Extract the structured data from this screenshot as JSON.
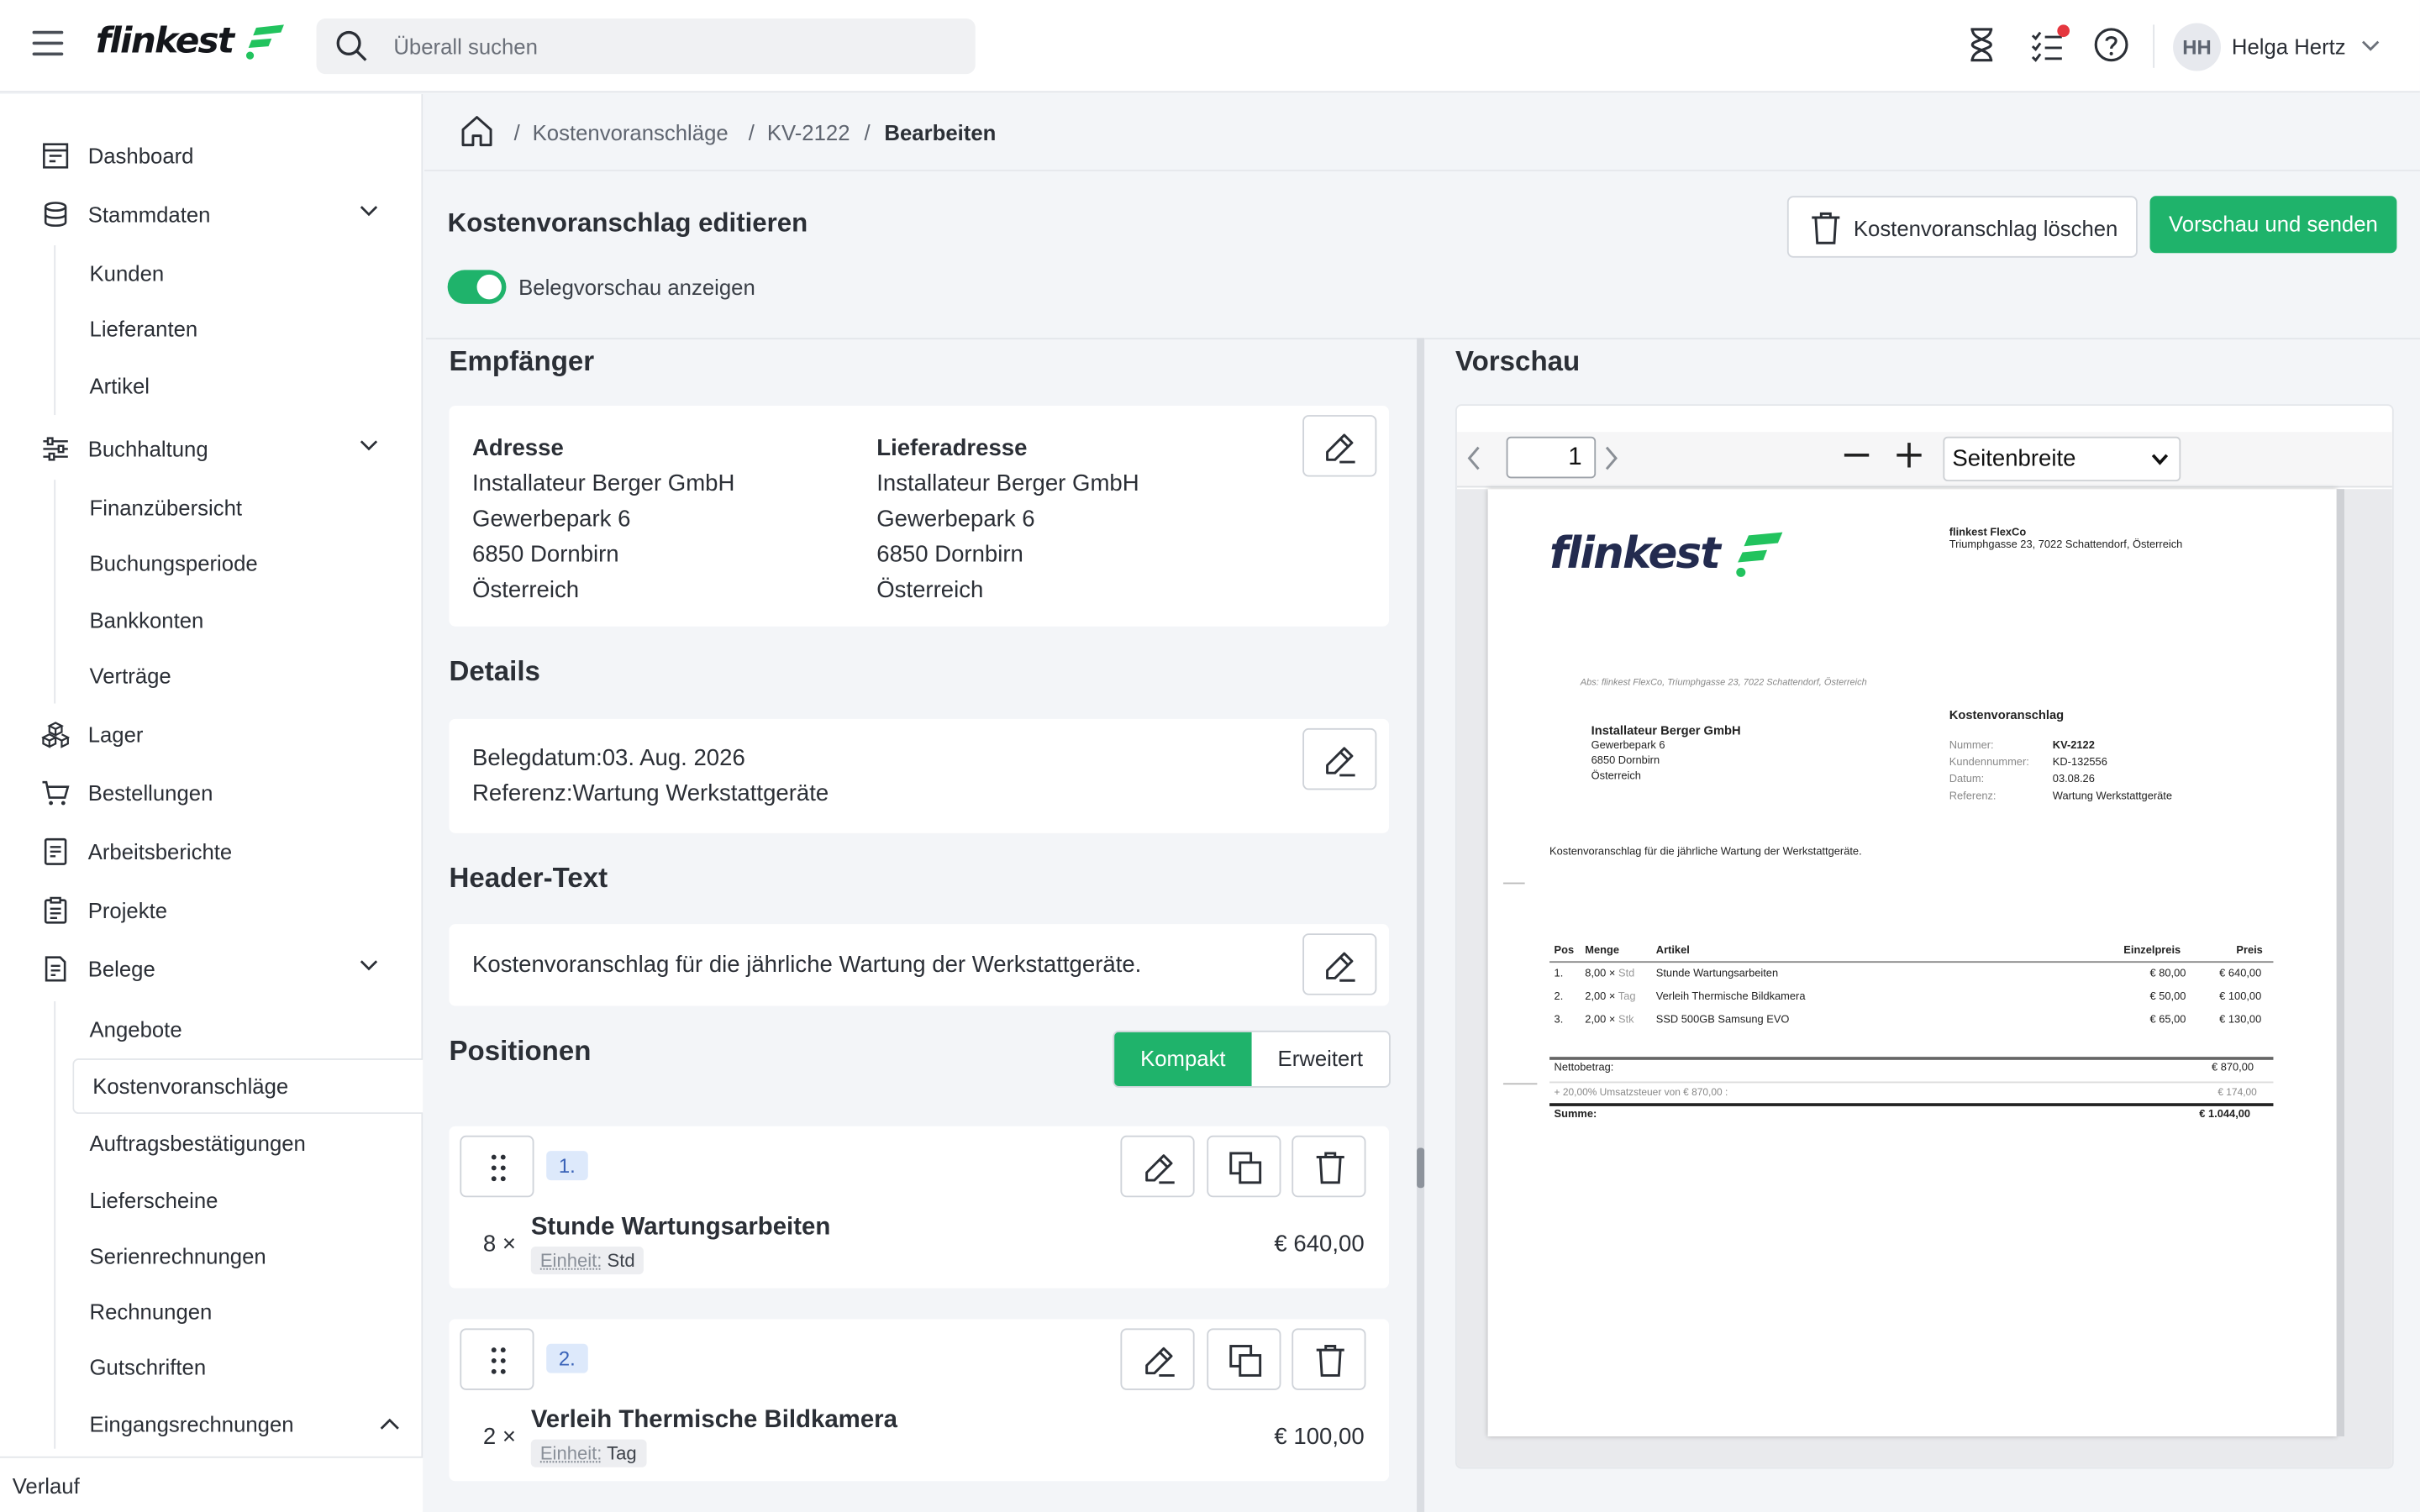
{
  "topbar": {
    "brand": "flinkest",
    "search_placeholder": "Überall suchen",
    "user_initials": "HH",
    "user_name": "Helga Hertz"
  },
  "sidebar": {
    "items": [
      {
        "label": "Dashboard"
      },
      {
        "label": "Stammdaten"
      },
      {
        "label": "Kunden"
      },
      {
        "label": "Lieferanten"
      },
      {
        "label": "Artikel"
      },
      {
        "label": "Buchhaltung"
      },
      {
        "label": "Finanzübersicht"
      },
      {
        "label": "Buchungsperiode"
      },
      {
        "label": "Bankkonten"
      },
      {
        "label": "Verträge"
      },
      {
        "label": "Lager"
      },
      {
        "label": "Bestellungen"
      },
      {
        "label": "Arbeitsberichte"
      },
      {
        "label": "Projekte"
      },
      {
        "label": "Belege"
      },
      {
        "label": "Angebote"
      },
      {
        "label": "Kostenvoranschläge"
      },
      {
        "label": "Auftragsbestätigungen"
      },
      {
        "label": "Lieferscheine"
      },
      {
        "label": "Serienrechnungen"
      },
      {
        "label": "Rechnungen"
      },
      {
        "label": "Gutschriften"
      },
      {
        "label": "Eingangsrechnungen"
      }
    ],
    "footer": "Verlauf"
  },
  "breadcrumb": {
    "items": [
      "Kostenvoranschläge",
      "KV-2122",
      "Bearbeiten"
    ],
    "separator": "/"
  },
  "header": {
    "title": "Kostenvoranschlag editieren",
    "toggle_label": "Belegvorschau anzeigen",
    "toggle_on": true,
    "delete_label": "Kostenvoranschlag löschen",
    "send_label": "Vorschau und senden"
  },
  "editor": {
    "recipient_title": "Empfänger",
    "address": {
      "heading": "Adresse",
      "lines": [
        "Installateur Berger GmbH",
        "Gewerbepark 6",
        "6850 Dornbirn",
        "Österreich"
      ]
    },
    "delivery_address": {
      "heading": "Lieferadresse",
      "lines": [
        "Installateur Berger GmbH",
        "Gewerbepark 6",
        "6850 Dornbirn",
        "Österreich"
      ]
    },
    "details_title": "Details",
    "details_lines": [
      "Belegdatum:03. Aug. 2026",
      "Referenz:Wartung Werkstattgeräte"
    ],
    "header_text_title": "Header-Text",
    "header_text": "Kostenvoranschlag für die jährliche Wartung der Werkstattgeräte.",
    "positions_title": "Positionen",
    "view_options": [
      "Kompakt",
      "Erweitert"
    ],
    "view_selected": "Kompakt",
    "positions": [
      {
        "num": "1.",
        "qty": "8 ×",
        "name": "Stunde Wartungsarbeiten",
        "unit_label": "Einheit:",
        "unit": "Std",
        "price": "€ 640,00"
      },
      {
        "num": "2.",
        "qty": "2 ×",
        "name": "Verleih Thermische Bildkamera",
        "unit_label": "Einheit:",
        "unit": "Tag",
        "price": "€ 100,00"
      }
    ]
  },
  "preview": {
    "title": "Vorschau",
    "page": "1",
    "zoom_option": "Seitenbreite",
    "doc": {
      "brand": "flinkest",
      "company": "flinkest FlexCo",
      "company_address": "Triumphgasse 23, 7022 Schattendorf, Österreich",
      "sender_line": "Abs: flinkest FlexCo, Triumphgasse 23, 7022 Schattendorf, Österreich",
      "recipient_name": "Installateur Berger GmbH",
      "recipient_lines": [
        "Gewerbepark 6",
        "6850 Dornbirn",
        "Österreich"
      ],
      "doc_type": "Kostenvoranschlag",
      "meta": [
        {
          "k": "Nummer:",
          "v": "KV-2122"
        },
        {
          "k": "Kundennummer:",
          "v": "KD-132556"
        },
        {
          "k": "Datum:",
          "v": "03.08.26"
        },
        {
          "k": "Referenz:",
          "v": "Wartung Werkstattgeräte"
        }
      ],
      "intro": "Kostenvoranschlag für die jährliche Wartung der Werkstattgeräte.",
      "table_headers": [
        "Pos",
        "Menge",
        "Artikel",
        "Einzelpreis",
        "Preis"
      ],
      "rows": [
        {
          "pos": "1.",
          "qty": "8,00 ×",
          "unit": "Std",
          "item": "Stunde Wartungsarbeiten",
          "unit_price": "€ 80,00",
          "price": "€ 640,00"
        },
        {
          "pos": "2.",
          "qty": "2,00 ×",
          "unit": "Tag",
          "item": "Verleih Thermische Bildkamera",
          "unit_price": "€ 50,00",
          "price": "€ 100,00"
        },
        {
          "pos": "3.",
          "qty": "2,00 ×",
          "unit": "Stk",
          "item": "SSD 500GB Samsung EVO",
          "unit_price": "€ 65,00",
          "price": "€ 130,00"
        }
      ],
      "net_label": "Nettobetrag:",
      "net_value": "€ 870,00",
      "tax_label": "+ 20,00% Umsatzsteuer von € 870,00 :",
      "tax_value": "€ 174,00",
      "sum_label": "Summe:",
      "sum_value": "€ 1.044,00"
    }
  },
  "colors": {
    "accent": "#1fb36b",
    "notification": "#e5373f",
    "badge_bg": "#dde9fb"
  }
}
